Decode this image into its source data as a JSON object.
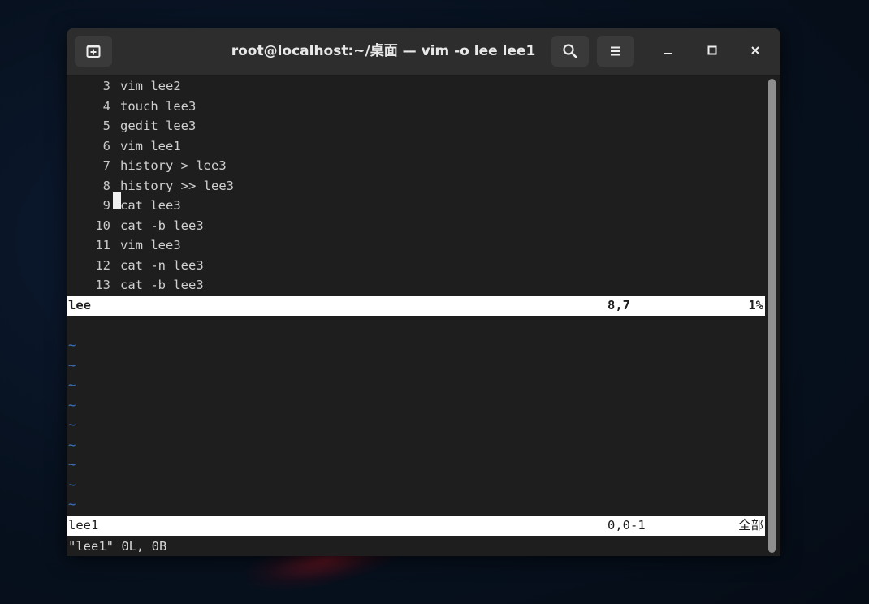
{
  "window": {
    "title": "root@localhost:~/桌面 — vim -o lee lee1"
  },
  "icons": {
    "new_tab": "new-tab-icon",
    "search": "search-icon",
    "menu": "hamburger-menu-icon",
    "minimize": "minimize-icon",
    "maximize": "maximize-icon",
    "close": "close-icon"
  },
  "upper_pane": {
    "lines": [
      {
        "num": "3",
        "text": "vim lee2"
      },
      {
        "num": "4",
        "text": "touch lee3"
      },
      {
        "num": "5",
        "text": "gedit lee3"
      },
      {
        "num": "6",
        "text": "vim lee1"
      },
      {
        "num": "7",
        "text": "history > lee3"
      },
      {
        "num": "8",
        "text": "history >> lee3"
      },
      {
        "num": "9",
        "text": "cat lee3"
      },
      {
        "num": "10",
        "text": "cat -b lee3"
      },
      {
        "num": "11",
        "text": "vim lee3"
      },
      {
        "num": "12",
        "text": "cat -n lee3"
      },
      {
        "num": "13",
        "text": "cat -b lee3"
      }
    ],
    "status": {
      "name": "lee",
      "position": "8,7",
      "percent": "1%"
    }
  },
  "lower_pane": {
    "tilde": "~",
    "status": {
      "name": "lee1",
      "position": "0,0-1",
      "percent": "全部"
    }
  },
  "command_line": "\"lee1\" 0L, 0B",
  "colors": {
    "terminal_bg": "#1e1e1e",
    "headerbar_bg": "#2d2d2d",
    "tilde": "#3a76c8",
    "statusbar_bg": "#ffffff"
  }
}
